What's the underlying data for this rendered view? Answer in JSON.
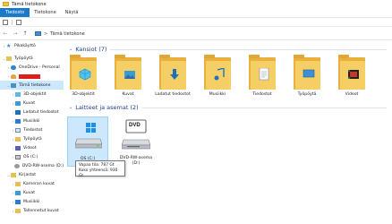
{
  "window": {
    "title": "Tämä tietokone"
  },
  "ribbon": {
    "tabs": [
      "Tiedosto",
      "Tietokone",
      "Näytä"
    ]
  },
  "address": {
    "path": "Tämä tietokone",
    "separator": ">"
  },
  "sidebar": {
    "items": [
      {
        "label": "Pikakäyttö",
        "icon": "star-icon",
        "indent": 0,
        "chevron": ">"
      },
      {
        "label": "",
        "icon": "user-folder-icon",
        "indent": 0,
        "chevron": "",
        "spacer": true
      },
      {
        "label": "Työpöytä",
        "icon": "desktop-folder-icon",
        "indent": 0,
        "chevron": "v"
      },
      {
        "label": "OneDrive - Personal",
        "icon": "cloud-icon",
        "indent": 1,
        "chevron": ">"
      },
      {
        "label": "",
        "icon": "user-icon",
        "indent": 1,
        "chevron": ">",
        "redacted": true
      },
      {
        "label": "Tämä tietokone",
        "icon": "pc-icon",
        "indent": 1,
        "chevron": "v",
        "selected": true
      },
      {
        "label": "3D-objektit",
        "icon": "objects-3d-icon",
        "indent": 2,
        "chevron": ">"
      },
      {
        "label": "Kuvat",
        "icon": "pictures-icon",
        "indent": 2,
        "chevron": ">"
      },
      {
        "label": "Ladatut tiedostot",
        "icon": "downloads-icon",
        "indent": 2,
        "chevron": ">"
      },
      {
        "label": "Musiikki",
        "icon": "music-icon",
        "indent": 2,
        "chevron": ">"
      },
      {
        "label": "Tiedostot",
        "icon": "documents-icon",
        "indent": 2,
        "chevron": ">"
      },
      {
        "label": "Työpöytä",
        "icon": "desktop-icon",
        "indent": 2,
        "chevron": ">"
      },
      {
        "label": "Videot",
        "icon": "videos-icon",
        "indent": 2,
        "chevron": ">"
      },
      {
        "label": "OS (C:)",
        "icon": "drive-icon",
        "indent": 2,
        "chevron": ">"
      },
      {
        "label": "DVD-RW-asema (D:)",
        "icon": "dvd-icon",
        "indent": 2,
        "chevron": ""
      },
      {
        "label": "Kirjastot",
        "icon": "library-icon",
        "indent": 1,
        "chevron": "v"
      },
      {
        "label": "Kameran kuvat",
        "icon": "camera-roll-icon",
        "indent": 2,
        "chevron": ">"
      },
      {
        "label": "Kuvat",
        "icon": "pictures-icon",
        "indent": 2,
        "chevron": ">"
      },
      {
        "label": "Musiikki",
        "icon": "music-icon",
        "indent": 2,
        "chevron": ">"
      },
      {
        "label": "Tallennetut kuvat",
        "icon": "saved-pictures-icon",
        "indent": 2,
        "chevron": ">"
      }
    ]
  },
  "folders": {
    "header": "Kansiot (7)",
    "items": [
      {
        "label": "3D-objektit",
        "icon": "objects-3d-icon"
      },
      {
        "label": "Kuvat",
        "icon": "pictures-icon"
      },
      {
        "label": "Ladatut tiedostot",
        "icon": "downloads-icon"
      },
      {
        "label": "Musiikki",
        "icon": "music-icon"
      },
      {
        "label": "Tiedostot",
        "icon": "documents-icon"
      },
      {
        "label": "Työpöytä",
        "icon": "desktop-icon"
      },
      {
        "label": "Videot",
        "icon": "videos-icon"
      }
    ]
  },
  "devices": {
    "header": "Laitteet ja asemat (2)",
    "items": [
      {
        "label": "OS (C:)",
        "icon": "drive-icon",
        "selected": true
      },
      {
        "label": "DVD-RW-asema (D:)",
        "icon": "dvd-drive-icon",
        "selected": false
      }
    ],
    "dvd_badge": "DVD"
  },
  "tooltip": {
    "free_space": "Vapaa tila: 787 Gt",
    "total_size": "Koko yhteensä: 930 Gt"
  },
  "colors": {
    "accent": "#1979ca",
    "selection": "#cce8ff",
    "folder": "#f5cf66",
    "header": "#1e3f8a"
  }
}
